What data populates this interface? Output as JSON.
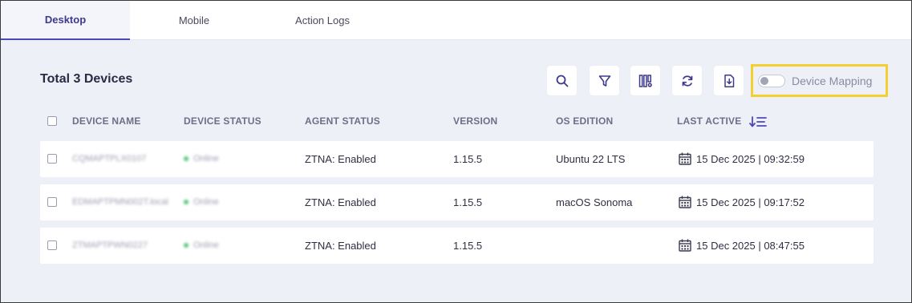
{
  "tabs": [
    {
      "label": "Desktop",
      "active": true
    },
    {
      "label": "Mobile",
      "active": false
    },
    {
      "label": "Action Logs",
      "active": false
    }
  ],
  "header": {
    "title": "Total 3 Devices",
    "device_mapping_label": "Device Mapping",
    "device_mapping_enabled": false
  },
  "toolbar": {
    "icons": [
      "search-icon",
      "filter-icon",
      "column-settings-icon",
      "refresh-icon",
      "export-icon"
    ]
  },
  "table": {
    "columns": [
      "DEVICE NAME",
      "DEVICE STATUS",
      "AGENT STATUS",
      "VERSION",
      "OS EDITION",
      "LAST ACTIVE"
    ],
    "rows": [
      {
        "device_name": "CQMAPTPLX0107",
        "device_status": "Online",
        "agent_status": "ZTNA: Enabled",
        "version": "1.15.5",
        "os_edition": "Ubuntu 22 LTS",
        "last_active": "15 Dec 2025 | 09:32:59"
      },
      {
        "device_name": "EDMAPTPMN002T.local",
        "device_status": "Online",
        "agent_status": "ZTNA: Enabled",
        "version": "1.15.5",
        "os_edition": "macOS Sonoma",
        "last_active": "15 Dec 2025 | 09:17:52"
      },
      {
        "device_name": "ZTMAPTPWN0227",
        "device_status": "Online",
        "agent_status": "ZTNA: Enabled",
        "version": "1.15.5",
        "os_edition": "",
        "last_active": "15 Dec 2025 | 08:47:55"
      }
    ]
  },
  "colors": {
    "accent": "#4d49b8",
    "online": "#55c477",
    "highlight": "#f2d12e"
  }
}
